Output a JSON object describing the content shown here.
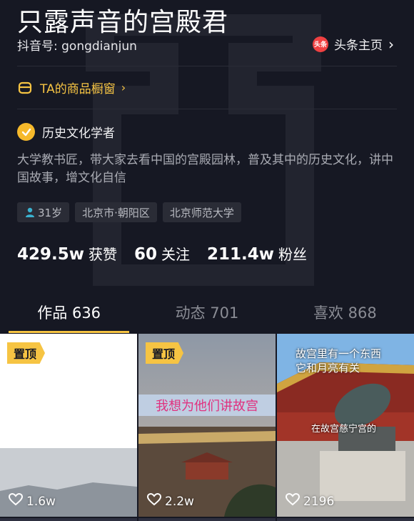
{
  "profile": {
    "name": "只露声音的宫殿君",
    "douyin_id": "抖音号: gongdianjun",
    "toutiao_logo_text": "头条",
    "toutiao_label": "头条主页",
    "shop_label": "TA的商品橱窗",
    "verify_label": "历史文化学者",
    "bio": "大学教书匠，带大家去看中国的宫殿园林，普及其中的历史文化，讲中国故事，增文化自信",
    "tags": {
      "age": "31岁",
      "location": "北京市·朝阳区",
      "school": "北京师范大学"
    }
  },
  "stats": {
    "likes": {
      "num": "429.5w",
      "label": "获赞"
    },
    "following": {
      "num": "60",
      "label": "关注"
    },
    "followers": {
      "num": "211.4w",
      "label": "粉丝"
    }
  },
  "tabs": {
    "works": "作品 636",
    "activity": "动态 701",
    "liked": "喜欢 868"
  },
  "videos": [
    {
      "pinned_label": "置顶",
      "likes": "1.6w"
    },
    {
      "pinned_label": "置顶",
      "likes": "2.2w",
      "caption": "我想为他们讲故宫"
    },
    {
      "likes": "2196",
      "caption_line1": "故宫里有一个东西",
      "caption_line2": "它和月亮有关",
      "caption_small": "在故宫慈宁宫的"
    }
  ],
  "colors": {
    "background": "#161823",
    "accent": "#f6c443",
    "toutiao_red": "#f04142"
  }
}
